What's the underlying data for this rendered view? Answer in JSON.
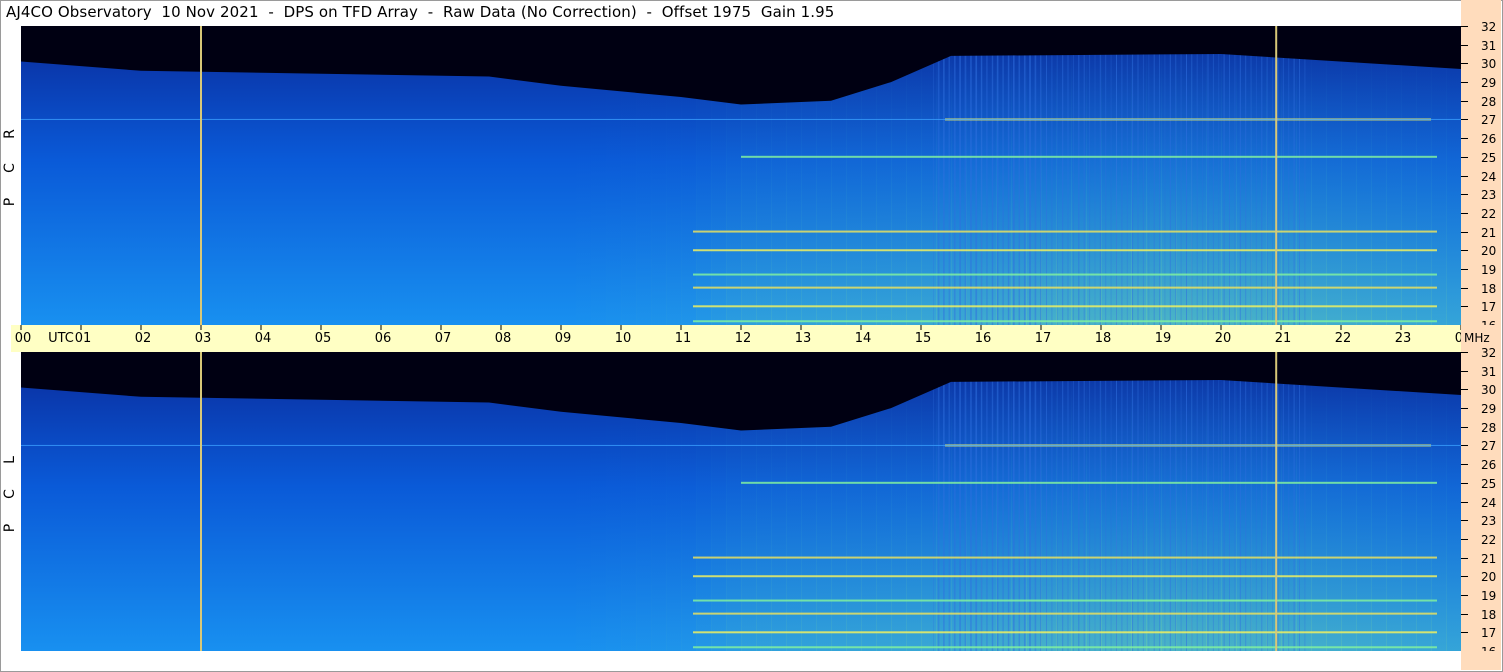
{
  "title": "AJ4CO Observatory  10 Nov 2021  -  DPS on TFD Array  -  Raw Data (No Correction)  -  Offset 1975  Gain 1.95",
  "panels": {
    "top_label": [
      "R",
      "C",
      "P"
    ],
    "bottom_label": [
      "L",
      "C",
      "P"
    ]
  },
  "time_axis": {
    "labels": [
      "00",
      "01",
      "02",
      "03",
      "04",
      "05",
      "06",
      "07",
      "08",
      "09",
      "10",
      "11",
      "12",
      "13",
      "14",
      "15",
      "16",
      "17",
      "18",
      "19",
      "20",
      "21",
      "22",
      "23",
      "00"
    ],
    "unit": "UTC"
  },
  "freq_axis": {
    "labels": [
      "32",
      "31",
      "30",
      "29",
      "28",
      "27",
      "26",
      "25",
      "24",
      "23",
      "22",
      "21",
      "20",
      "19",
      "18",
      "17",
      "16"
    ],
    "unit": "MHz"
  },
  "chart_data": {
    "type": "heatmap",
    "title": "AJ4CO Observatory  10 Nov 2021  -  DPS on TFD Array  -  Raw Data (No Correction)  -  Offset 1975  Gain 1.95",
    "x_range_hours_utc": [
      0,
      24
    ],
    "y_range_mhz": [
      16,
      32
    ],
    "panels": [
      "RCP",
      "LCP"
    ],
    "colormap": [
      "#000010",
      "#00186c",
      "#0050d0",
      "#1a98f0",
      "#58e0b0",
      "#f0f060",
      "#ff4040"
    ],
    "vertical_markers_utc": [
      3.0,
      20.92
    ],
    "background_cutoff_mhz": [
      {
        "utc": 0.0,
        "mhz": 30.1
      },
      {
        "utc": 2.0,
        "mhz": 29.6
      },
      {
        "utc": 7.8,
        "mhz": 29.3
      },
      {
        "utc": 9.0,
        "mhz": 28.8
      },
      {
        "utc": 11.0,
        "mhz": 28.2
      },
      {
        "utc": 12.0,
        "mhz": 27.8
      },
      {
        "utc": 13.5,
        "mhz": 28.0
      },
      {
        "utc": 14.5,
        "mhz": 29.0
      },
      {
        "utc": 15.5,
        "mhz": 30.4
      },
      {
        "utc": 20.0,
        "mhz": 30.5
      },
      {
        "utc": 24.0,
        "mhz": 29.7
      }
    ],
    "brightness_profile": [
      {
        "utc": 0,
        "level": 0.35
      },
      {
        "utc": 6,
        "level": 0.38
      },
      {
        "utc": 9,
        "level": 0.4
      },
      {
        "utc": 11,
        "level": 0.45
      },
      {
        "utc": 12,
        "level": 0.55
      },
      {
        "utc": 15,
        "level": 0.62
      },
      {
        "utc": 17,
        "level": 0.7
      },
      {
        "utc": 19,
        "level": 0.74
      },
      {
        "utc": 21,
        "level": 0.7
      },
      {
        "utc": 24,
        "level": 0.58
      }
    ],
    "interference_lines_mhz": [
      27.0,
      25.0,
      21.0,
      20.0,
      18.7,
      18.0,
      17.0,
      16.2
    ]
  }
}
